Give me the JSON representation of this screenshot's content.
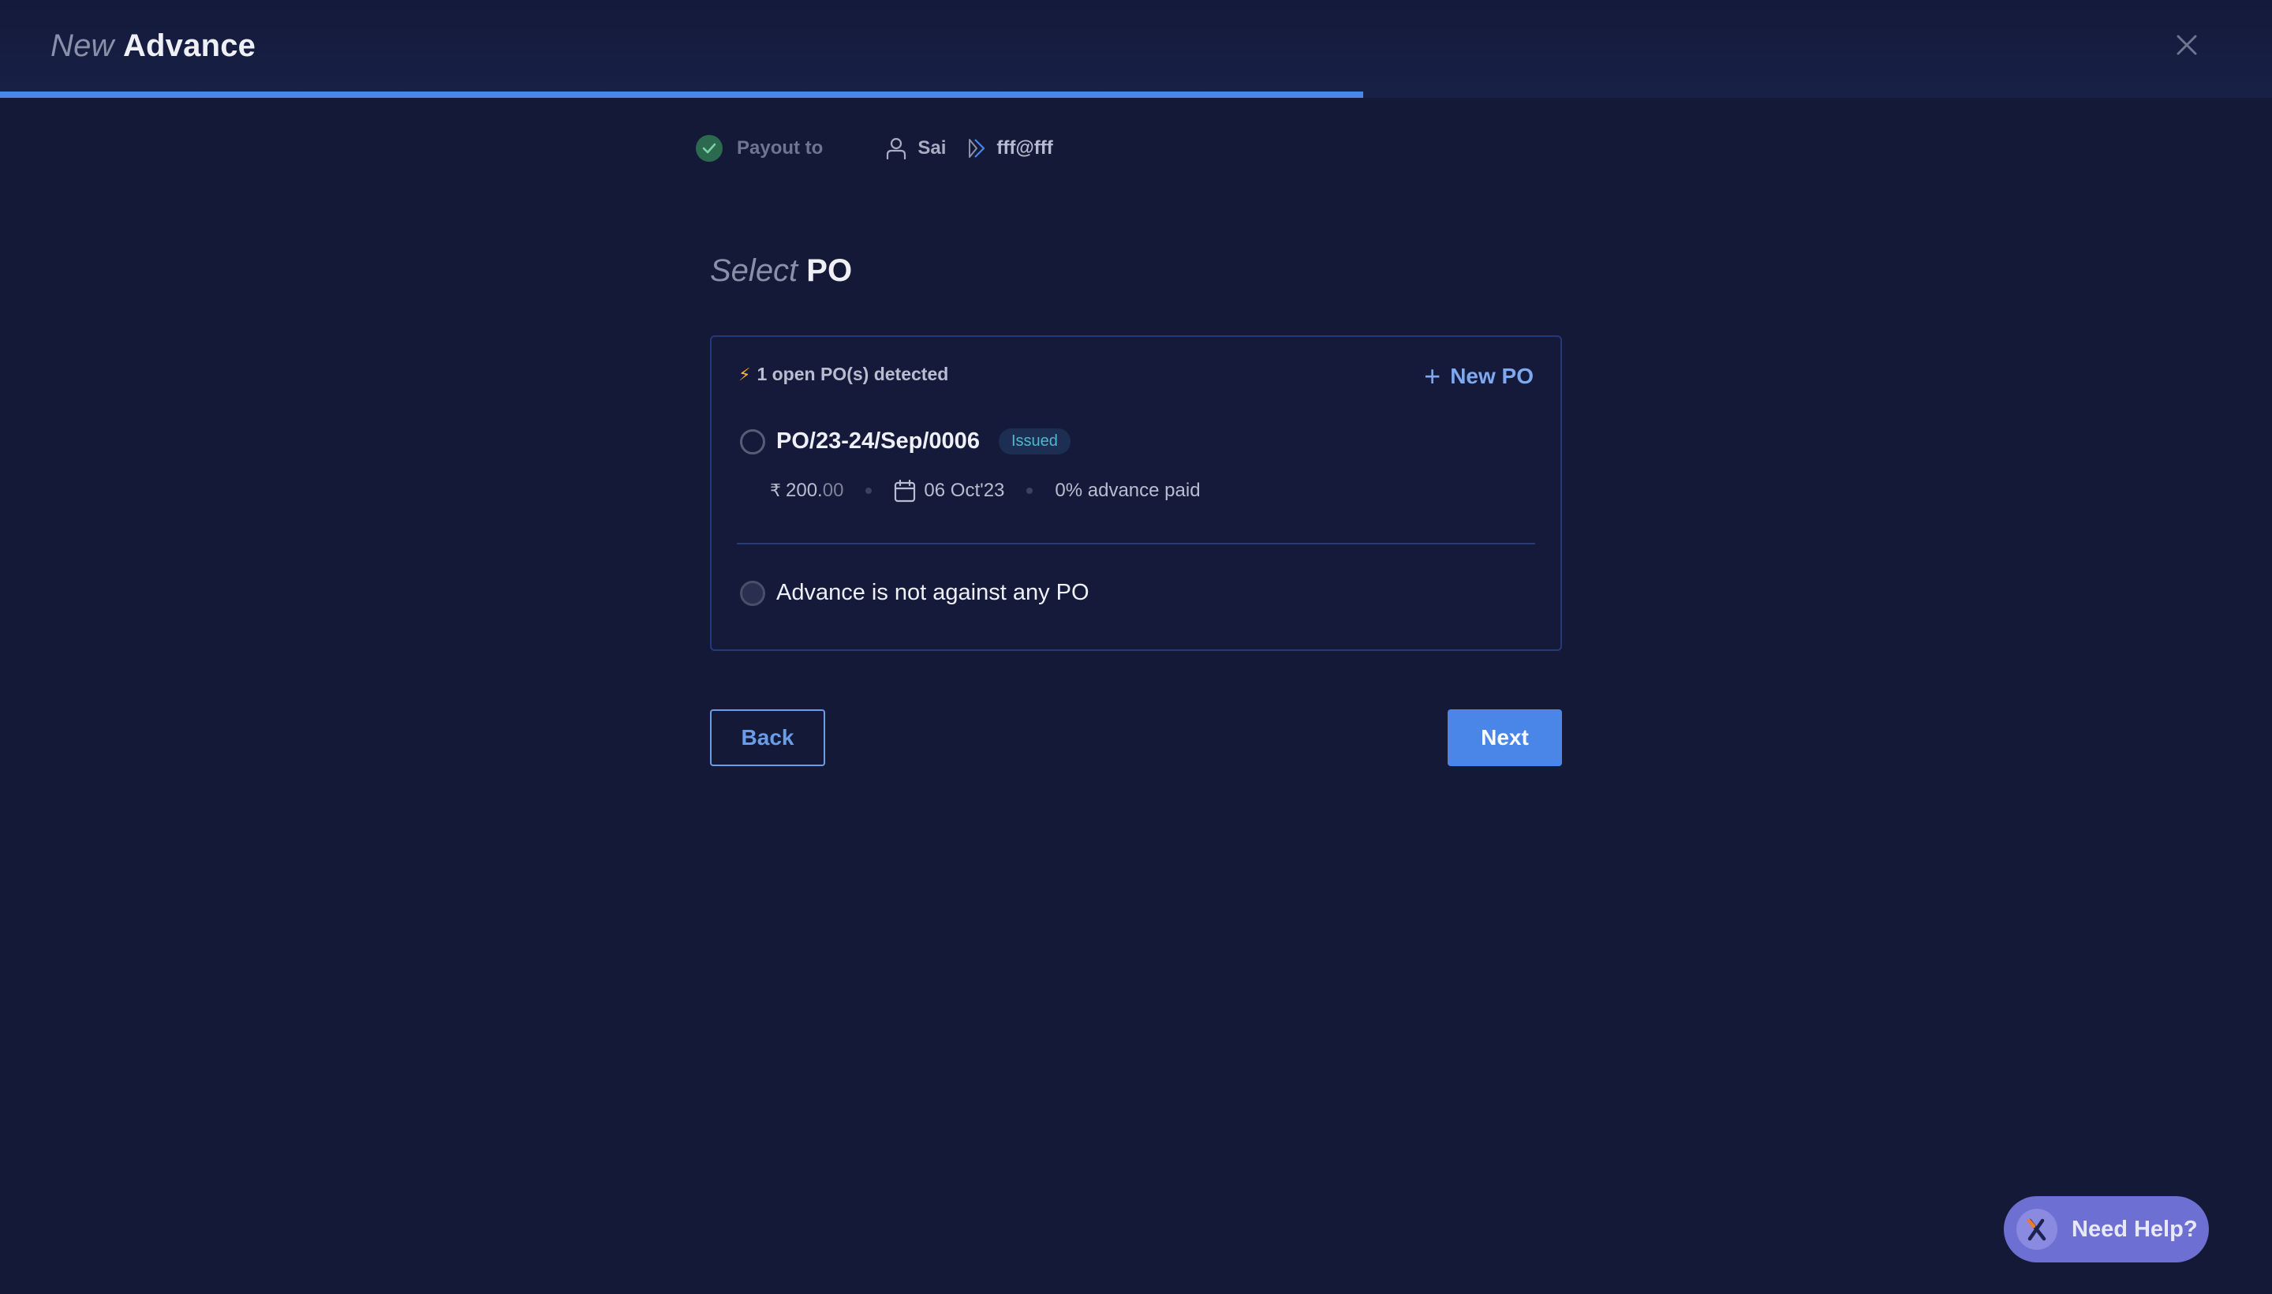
{
  "header": {
    "title_prefix": "New",
    "title_main": "Advance",
    "close_icon": "close-icon",
    "progress_percent": 60
  },
  "stepper": {
    "step_label": "Payout to",
    "step_status_icon": "check-circle-icon",
    "payee_name": "Sai",
    "payee_icon": "user-icon",
    "upi_id": "fff@fff",
    "upi_icon": "upi-icon"
  },
  "section": {
    "title_prefix": "Select",
    "title_main": "PO"
  },
  "po_card": {
    "detected_icon": "lightning-icon",
    "detected_text": "1 open PO(s) detected",
    "new_po_label": "New PO",
    "new_po_icon": "plus-icon",
    "purchase_orders": [
      {
        "number": "PO/23-24/Sep/0006",
        "status": "Issued",
        "currency_symbol": "₹",
        "amount_whole": "200.",
        "amount_cents": "00",
        "date": "06 Oct'23",
        "advance_paid": "0% advance paid",
        "selected": false
      }
    ],
    "no_po_option": "Advance is not against any PO"
  },
  "actions": {
    "back_label": "Back",
    "next_label": "Next"
  },
  "help": {
    "label": "Need Help?",
    "logo_icon": "brand-logo-icon"
  },
  "colors": {
    "accent": "#4a86e8",
    "background": "#141938",
    "success": "#2b6a4f",
    "badge_text": "#4fb7cf",
    "help_bg": "#6e6fd2"
  }
}
